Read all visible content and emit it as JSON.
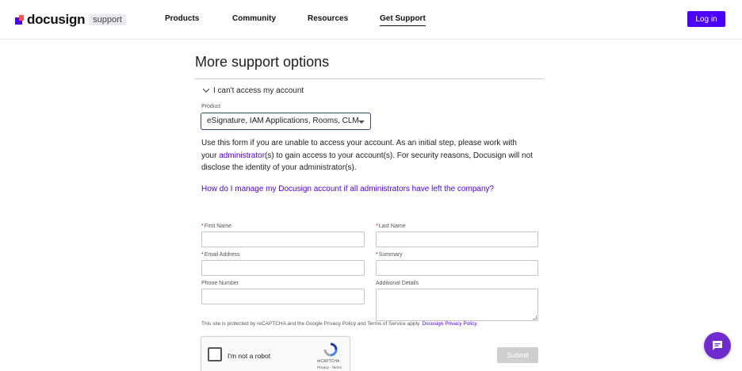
{
  "header": {
    "logo_text": "docusign",
    "logo_badge": "support",
    "nav": [
      {
        "label": "Products"
      },
      {
        "label": "Community"
      },
      {
        "label": "Resources"
      },
      {
        "label": "Get Support"
      }
    ],
    "login_label": "Log in"
  },
  "main": {
    "title": "More support options",
    "accordion_label": "I can't access my account",
    "product": {
      "label": "Product",
      "selected": "eSignature, IAM Applications, Rooms, CLM"
    },
    "body": {
      "part1": "Use this form if you are unable to access your account. As an initial step, please work with your ",
      "link": "administrator",
      "part2": "(s) to gain access to your account(s). For security reasons, Docusign will not disclose the identity of your administrator(s)."
    },
    "help_link": "How do I manage my Docusign account if all administrators have left the company?",
    "form": {
      "required_mark": "*",
      "first_name": "First Name",
      "last_name": "Last Name",
      "email": "Email Address",
      "summary": "Summary",
      "phone": "Phone Number",
      "details": "Additional Details"
    },
    "recaptcha_note": "This site is protected by reCAPTCHA and the Google Privacy Policy and Terms of Service apply.",
    "privacy_link": "Docusign Privacy Policy.",
    "captcha": {
      "label": "I'm not a robot",
      "brand": "reCAPTCHA",
      "terms": "Privacy - Terms"
    },
    "submit_label": "Submit"
  },
  "colors": {
    "brand": "#4c00ff",
    "chat": "#6f2bd0",
    "required": "#d0021b"
  }
}
